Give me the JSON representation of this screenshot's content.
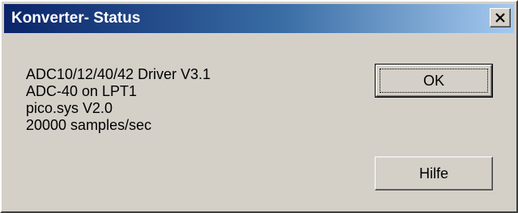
{
  "window": {
    "title": "Konverter- Status",
    "close_icon": "close-x-icon"
  },
  "info": {
    "lines": [
      "ADC10/12/40/42 Driver V3.1",
      "ADC-40 on LPT1",
      "pico.sys V2.0",
      "20000 samples/sec"
    ]
  },
  "buttons": {
    "ok_label": "OK",
    "help_label": "Hilfe"
  }
}
